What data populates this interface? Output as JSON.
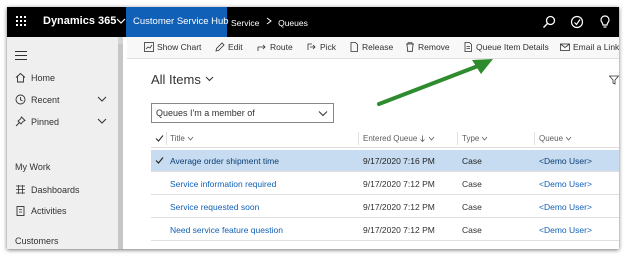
{
  "app": {
    "brand": "Dynamics 365",
    "app_name": "Customer Service Hub",
    "breadcrumb": [
      "Service",
      "Queues"
    ]
  },
  "topbar_icons": [
    "search-icon",
    "assistant-icon",
    "lightbulb-icon"
  ],
  "sidenav": {
    "items": [
      {
        "label": "Home",
        "icon": "home-icon"
      },
      {
        "label": "Recent",
        "icon": "clock-icon"
      },
      {
        "label": "Pinned",
        "icon": "pin-icon"
      }
    ],
    "sections": [
      {
        "title": "My Work",
        "items": [
          {
            "label": "Dashboards",
            "icon": "dashboard-icon"
          },
          {
            "label": "Activities",
            "icon": "clipboard-icon"
          }
        ]
      },
      {
        "title": "Customers",
        "items": []
      }
    ]
  },
  "commands": [
    {
      "label": "Show Chart",
      "icon": "chart-icon"
    },
    {
      "label": "Edit",
      "icon": "pencil-icon"
    },
    {
      "label": "Route",
      "icon": "route-icon"
    },
    {
      "label": "Pick",
      "icon": "pick-icon"
    },
    {
      "label": "Release",
      "icon": "document-icon"
    },
    {
      "label": "Remove",
      "icon": "trash-icon"
    },
    {
      "label": "Queue Item Details",
      "icon": "details-icon"
    },
    {
      "label": "Email a Link",
      "icon": "email-icon"
    }
  ],
  "view": {
    "title": "All Items",
    "filter": "Queues I'm a member of"
  },
  "grid": {
    "columns": [
      "Title",
      "Entered Queue",
      "Type",
      "Queue"
    ],
    "rows": [
      {
        "title": "Average order shipment time",
        "entered": "9/17/2020 7:16 PM",
        "type": "Case",
        "queue": "<Demo User>",
        "selected": true
      },
      {
        "title": "Service information required",
        "entered": "9/17/2020 7:12 PM",
        "type": "Case",
        "queue": "<Demo User>",
        "selected": false
      },
      {
        "title": "Service requested soon",
        "entered": "9/17/2020 7:12 PM",
        "type": "Case",
        "queue": "<Demo User>",
        "selected": false
      },
      {
        "title": "Need service feature question",
        "entered": "9/17/2020 7:12 PM",
        "type": "Case",
        "queue": "<Demo User>",
        "selected": false
      }
    ]
  },
  "colors": {
    "topbar": "#000000",
    "app_tab": "#1160b7",
    "link": "#1160b7",
    "selected_row": "#c7dcf0",
    "annotation_arrow": "#2e8b2e"
  }
}
